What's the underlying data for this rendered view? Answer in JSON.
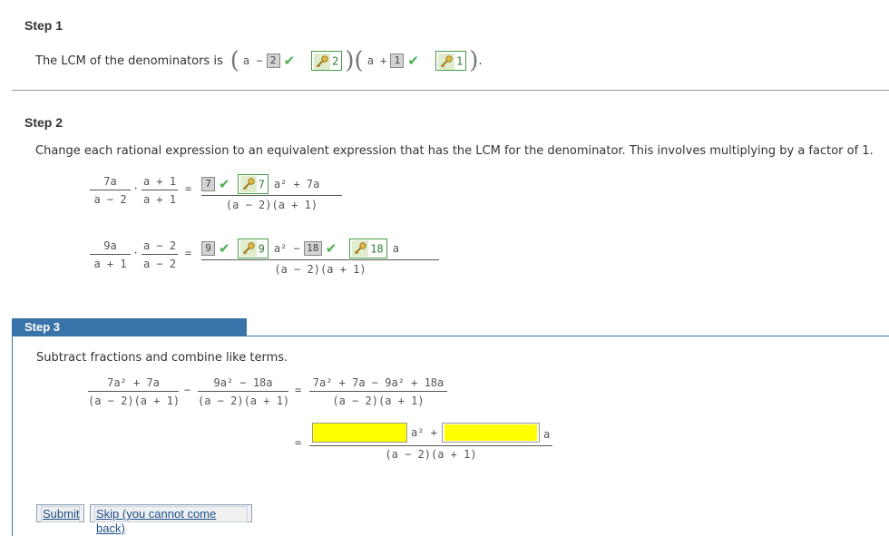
{
  "step1": {
    "title": "Step 1",
    "prompt": "The LCM of the denominators is",
    "factor1_var": "a −",
    "factor1_answer": "2",
    "factor1_key": "2",
    "factor2_var": "a +",
    "factor2_answer": "1",
    "factor2_key": "1",
    "end": "."
  },
  "step2": {
    "title": "Step 2",
    "instruction": "Change each rational expression to an equivalent expression that has the LCM for the denominator. This involves multiplying by a factor of 1.",
    "row1": {
      "f1_num": "7a",
      "f1_den": "a − 2",
      "f2_num": "a + 1",
      "f2_den": "a + 1",
      "answer": "7",
      "key": "7",
      "num_tail": "a² + 7a",
      "den": "(a − 2)(a + 1)"
    },
    "row2": {
      "f1_num": "9a",
      "f1_den": "a + 1",
      "f2_num": "a − 2",
      "f2_den": "a − 2",
      "answer1": "9",
      "key1": "9",
      "mid": "a² −",
      "answer2": "18",
      "key2": "18",
      "tail": "a",
      "den": "(a − 2)(a + 1)"
    },
    "dot": "·",
    "eq": "="
  },
  "step3": {
    "title": "Step 3",
    "instruction": "Subtract fractions and combine like terms.",
    "l_num": "7a² + 7a",
    "l_den": "(a − 2)(a + 1)",
    "minus": "−",
    "r_num": "9a² − 18a",
    "r_den": "(a − 2)(a + 1)",
    "eq": "=",
    "c_num": "7a² + 7a − 9a² + 18a",
    "c_den": "(a − 2)(a + 1)",
    "final_mid": "a² +",
    "final_tail": "a",
    "final_den": "(a − 2)(a + 1)",
    "input1_value": "",
    "input2_value": ""
  },
  "buttons": {
    "submit": "Submit",
    "skip": "Skip (you cannot come back)"
  },
  "colors": {
    "step3_header": "#3a73aa",
    "highlight": "#ffff00",
    "check": "#4caf50"
  }
}
